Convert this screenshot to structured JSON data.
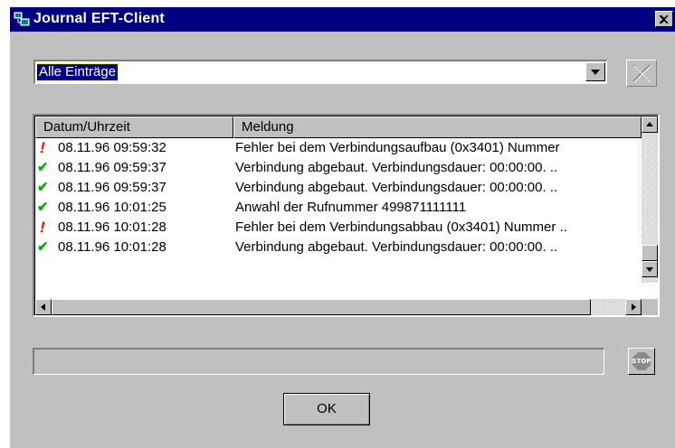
{
  "window": {
    "title": "Journal EFT-Client"
  },
  "filter": {
    "selected": "Alle Einträge"
  },
  "list": {
    "columns": [
      "Datum/Uhrzeit",
      "Meldung"
    ],
    "rows": [
      {
        "status": "error",
        "icon": "!",
        "datetime": "08.11.96  09:59:32",
        "message": "Fehler bei dem Verbindungsaufbau (0x3401) Nummer"
      },
      {
        "status": "ok",
        "icon": "✔",
        "datetime": "08.11.96  09:59:37",
        "message": "Verbindung abgebaut. Verbindungsdauer: 00:00:00. .."
      },
      {
        "status": "ok",
        "icon": "✔",
        "datetime": "08.11.96  09:59:37",
        "message": "Verbindung abgebaut. Verbindungsdauer: 00:00:00. .."
      },
      {
        "status": "ok",
        "icon": "✔",
        "datetime": "08.11.96  10:01:25",
        "message": "Anwahl der Rufnummer 499871111111"
      },
      {
        "status": "error",
        "icon": "!",
        "datetime": "08.11.96  10:01:28",
        "message": "Fehler bei dem Verbindungsabbau (0x3401) Nummer .."
      },
      {
        "status": "ok",
        "icon": "✔",
        "datetime": "08.11.96  10:01:28",
        "message": "Verbindung abgebaut. Verbindungsdauer: 00:00:00. .."
      }
    ]
  },
  "stop_button": {
    "label": "STOP"
  },
  "ok_button": {
    "label": "OK"
  },
  "colors": {
    "titlebar": "#000080",
    "face": "#c0c0c0",
    "error": "#ff0000",
    "ok": "#00b000"
  }
}
